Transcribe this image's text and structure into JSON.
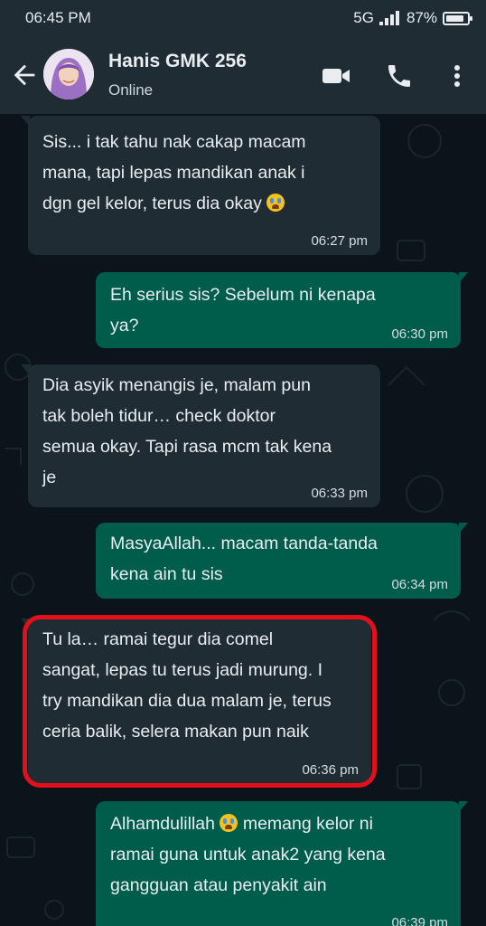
{
  "status_bar": {
    "time": "06:45 PM",
    "network": "5G",
    "battery": "87%",
    "battery_level": 0.87
  },
  "header": {
    "name": "Hanis GMK 256",
    "status": "Online"
  },
  "icons": [
    "back-arrow-icon",
    "video-call-icon",
    "phone-icon",
    "more-options-icon"
  ],
  "messages": [
    {
      "dir": "in",
      "text": "Sis... i tak tahu nak cakap macam\nmana, tapi lepas mandikan anak i\ndgn gel kelor, terus dia okay",
      "emoji_after": true,
      "time": "06:27 pm"
    },
    {
      "dir": "out",
      "text": "Eh serius sis? Sebelum ni kenapa\nya?",
      "time": "06:30 pm"
    },
    {
      "dir": "in",
      "text": "Dia asyik menangis je, malam pun\ntak boleh tidur… check doktor\nsemua okay. Tapi rasa mcm tak kena\nje",
      "time": "06:33 pm"
    },
    {
      "dir": "out",
      "text": "MasyaAllah... macam tanda-tanda\nkena ain tu sis",
      "time": "06:34 pm"
    },
    {
      "dir": "in",
      "text": "Tu la… ramai tegur dia comel\nsangat, lepas tu terus jadi murung. I\ntry mandikan dia dua malam je, terus\nceria balik, selera makan pun naik",
      "time": "06:36 pm",
      "highlighted": true
    },
    {
      "dir": "out",
      "text_before_emoji": "Alhamdulillah",
      "text": "memang kelor ni\nramai guna untuk anak2 yang kena\ngangguan atau penyakit ain",
      "time": "06:39 pm"
    }
  ],
  "colors": {
    "incoming": "#202c33",
    "outgoing": "#005c4b",
    "header": "#1f2c33",
    "highlight": "#e3101b"
  }
}
